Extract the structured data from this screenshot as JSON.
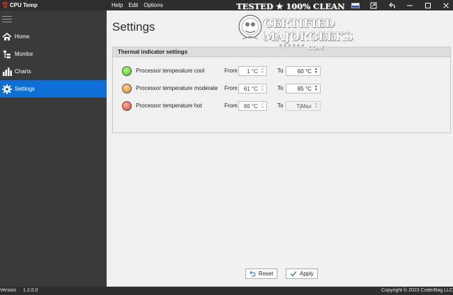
{
  "app": {
    "title": "CPU Temp"
  },
  "menu": [
    {
      "label": "Help"
    },
    {
      "label": "Edit"
    },
    {
      "label": "Options"
    }
  ],
  "window_icons": [
    "language-flag-icon",
    "export-icon",
    "undo-icon",
    "minimize-icon",
    "maximize-icon",
    "close-icon"
  ],
  "sidebar": {
    "items": [
      {
        "label": "Home",
        "icon": "home-icon",
        "active": false
      },
      {
        "label": "Monitor",
        "icon": "monitor-tree-icon",
        "active": false
      },
      {
        "label": "Charts",
        "icon": "bar-chart-icon",
        "active": false
      },
      {
        "label": "Settings",
        "icon": "gear-icon",
        "active": true
      }
    ]
  },
  "main": {
    "title": "Settings",
    "group": {
      "title": "Thermal indicator settings",
      "from_label": "From",
      "to_label": "To",
      "rows": [
        {
          "name": "Processor temperature cool",
          "color": "#6ddb3a",
          "from": "1 °C",
          "to": "60 °C"
        },
        {
          "name": "Processor temperature moderate",
          "color": "#f0a548",
          "from": "61 °C",
          "to": "85 °C"
        },
        {
          "name": "Processor temperature hot",
          "color": "#ee6b55",
          "from": "86 °C",
          "to": "TjMax"
        }
      ]
    },
    "buttons": {
      "reset": "Reset",
      "apply": "Apply"
    }
  },
  "status": {
    "version_label": "Version",
    "version": "1.2.0.0",
    "copyright": "Copyright © 2023 CoderBag LLC"
  },
  "watermark": {
    "line1": "TESTED ★ 100% CLEAN",
    "line2": "CERTIFIED",
    "line3": "MAJORGEEKS",
    "line4": "★★★★★★",
    "line5": ".COM"
  },
  "colors": {
    "accent": "#0e6fd6",
    "sidebar_bg": "#3a3a3a",
    "titlebar_bg": "#2e2e2e",
    "content_bg": "#f0f0f0"
  }
}
